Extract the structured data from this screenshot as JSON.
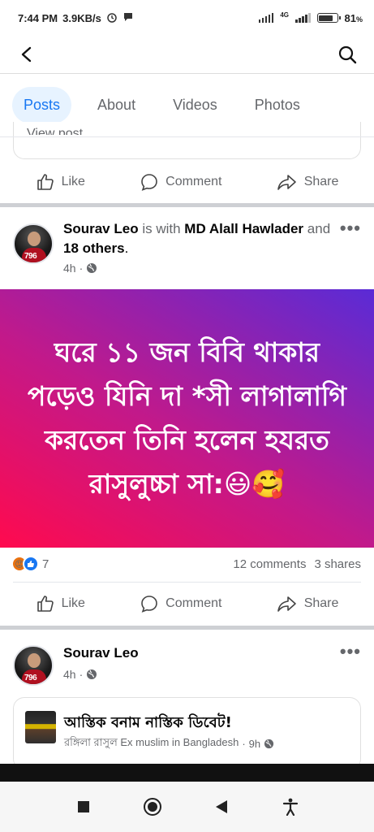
{
  "status_bar": {
    "time": "7:44 PM",
    "speed": "3.9KB/s",
    "battery": "81",
    "battery_unit": "%",
    "network_label": "4G"
  },
  "header": {
    "back_icon": "chevron-left-icon",
    "search_icon": "search-icon"
  },
  "tabs": [
    {
      "label": "Posts",
      "active": true
    },
    {
      "label": "About",
      "active": false
    },
    {
      "label": "Videos",
      "active": false
    },
    {
      "label": "Photos",
      "active": false
    }
  ],
  "partial_post": {
    "cut_text": "View post"
  },
  "actions": {
    "like": "Like",
    "comment": "Comment",
    "share": "Share"
  },
  "post1": {
    "author": "Sourav Leo",
    "with_text": "is with",
    "tagged": "MD Alall Hawlader",
    "and_text": "and",
    "others": "18 others",
    "period": ".",
    "time": "4h",
    "body": "ঘরে ১১ জন বিবি থাকার পড়েও যিনি দা *সী লাগালাগি করতেন তিনি হলেন হযরত রাসুলুচ্চা সা:😃🥰",
    "reaction_count": "7",
    "comments": "12 comments",
    "shares": "3 shares"
  },
  "post2": {
    "author": "Sourav Leo",
    "time": "4h",
    "shared_title": "আস্তিক বনাম নাস্তিক ডিবেট!",
    "shared_source": "রঙ্গিলা রাসুল Ex muslim in Bangladesh",
    "shared_time": "9h"
  },
  "avatar_number": "796",
  "colors": {
    "accent": "#1877f2",
    "tab_active_bg": "#e7f3ff",
    "gradient_start": "#ff0a4e",
    "gradient_end": "#5a2bd6"
  }
}
